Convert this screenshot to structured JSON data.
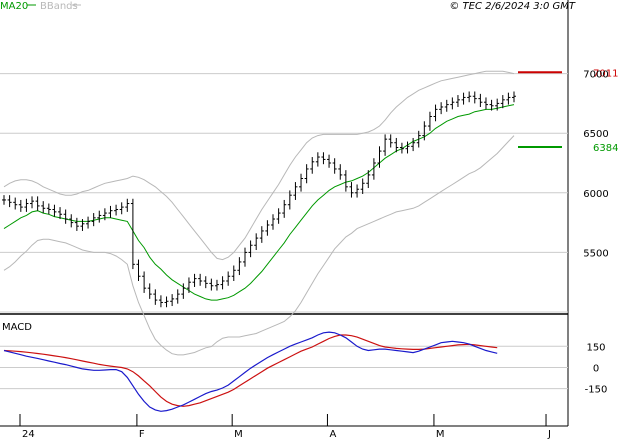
{
  "header": {
    "legend_ma": "MA20",
    "legend_bb": "BBands",
    "copyright": "© TEC 2/6/2024 3:0 GMT"
  },
  "macd_label": "MACD",
  "colors": {
    "price_bar": "#000000",
    "ma20": "#009900",
    "bbands": "#b8b8b8",
    "resistance": "#cc0000",
    "support": "#009900",
    "macd_line": "#1a1acc",
    "signal_line": "#cc1111",
    "grid": "#cccccc",
    "frame": "#000000"
  },
  "chart_data": [
    {
      "type": "ohlc",
      "name": "price",
      "x_tick_labels": [
        "24",
        "F",
        "M",
        "A",
        "M",
        "J"
      ],
      "x_tick_indices": [
        0,
        23,
        40,
        57,
        76,
        96
      ],
      "y_tick_labels": [
        "7000",
        "6500",
        "6000",
        "5500"
      ],
      "y_ticks": [
        7000,
        6500,
        6000,
        5500
      ],
      "ylim": [
        5000,
        7500
      ],
      "levels": [
        {
          "label": "7011",
          "value": 7011,
          "color": "#cc0000"
        },
        {
          "label": "6384",
          "value": 6384,
          "color": "#009900"
        }
      ],
      "close": [
        5940,
        5920,
        5900,
        5880,
        5910,
        5930,
        5890,
        5870,
        5860,
        5840,
        5820,
        5780,
        5750,
        5720,
        5740,
        5760,
        5790,
        5810,
        5830,
        5850,
        5860,
        5880,
        5910,
        5400,
        5300,
        5200,
        5150,
        5100,
        5080,
        5090,
        5110,
        5150,
        5200,
        5250,
        5280,
        5260,
        5240,
        5220,
        5230,
        5260,
        5300,
        5350,
        5420,
        5500,
        5560,
        5620,
        5680,
        5730,
        5780,
        5830,
        5900,
        5980,
        6050,
        6120,
        6200,
        6260,
        6300,
        6280,
        6250,
        6200,
        6150,
        6050,
        6000,
        6030,
        6080,
        6150,
        6250,
        6350,
        6450,
        6420,
        6380,
        6370,
        6390,
        6420,
        6480,
        6560,
        6640,
        6700,
        6720,
        6740,
        6760,
        6780,
        6800,
        6810,
        6790,
        6760,
        6740,
        6730,
        6750,
        6780,
        6800,
        6810
      ],
      "ma20": [
        5700,
        5730,
        5760,
        5790,
        5810,
        5840,
        5850,
        5830,
        5820,
        5800,
        5790,
        5780,
        5770,
        5760,
        5760,
        5760,
        5770,
        5780,
        5790,
        5790,
        5780,
        5770,
        5760,
        5680,
        5600,
        5540,
        5460,
        5400,
        5360,
        5310,
        5270,
        5240,
        5210,
        5180,
        5150,
        5130,
        5110,
        5100,
        5100,
        5110,
        5120,
        5140,
        5170,
        5200,
        5240,
        5290,
        5340,
        5400,
        5460,
        5520,
        5580,
        5650,
        5710,
        5770,
        5830,
        5890,
        5940,
        5980,
        6020,
        6050,
        6070,
        6090,
        6100,
        6120,
        6140,
        6170,
        6210,
        6250,
        6290,
        6320,
        6350,
        6370,
        6400,
        6430,
        6450,
        6470,
        6500,
        6540,
        6570,
        6600,
        6620,
        6640,
        6650,
        6660,
        6680,
        6690,
        6700,
        6700,
        6710,
        6720,
        6730,
        6740
      ],
      "bb_upper": [
        6050,
        6080,
        6100,
        6110,
        6110,
        6100,
        6080,
        6050,
        6030,
        6010,
        5990,
        5980,
        5980,
        5990,
        6010,
        6020,
        6040,
        6060,
        6080,
        6090,
        6100,
        6110,
        6120,
        6140,
        6130,
        6110,
        6080,
        6050,
        6010,
        5970,
        5920,
        5860,
        5800,
        5740,
        5680,
        5620,
        5560,
        5500,
        5450,
        5440,
        5460,
        5500,
        5560,
        5620,
        5700,
        5780,
        5860,
        5930,
        6000,
        6070,
        6150,
        6230,
        6300,
        6360,
        6420,
        6460,
        6480,
        6490,
        6490,
        6490,
        6490,
        6490,
        6490,
        6490,
        6500,
        6510,
        6530,
        6560,
        6610,
        6670,
        6720,
        6760,
        6800,
        6830,
        6860,
        6880,
        6900,
        6920,
        6940,
        6950,
        6960,
        6970,
        6980,
        6990,
        7000,
        7010,
        7020,
        7020,
        7020,
        7020,
        7010,
        7000
      ],
      "bb_lower": [
        5350,
        5380,
        5420,
        5470,
        5510,
        5560,
        5600,
        5610,
        5610,
        5600,
        5590,
        5580,
        5560,
        5540,
        5520,
        5510,
        5500,
        5500,
        5500,
        5490,
        5470,
        5440,
        5400,
        5220,
        5080,
        4970,
        4860,
        4770,
        4720,
        4680,
        4650,
        4640,
        4640,
        4650,
        4660,
        4680,
        4700,
        4710,
        4750,
        4780,
        4790,
        4790,
        4790,
        4800,
        4810,
        4820,
        4840,
        4860,
        4880,
        4900,
        4920,
        4960,
        5010,
        5080,
        5160,
        5240,
        5320,
        5390,
        5460,
        5530,
        5580,
        5630,
        5660,
        5700,
        5720,
        5740,
        5760,
        5780,
        5800,
        5820,
        5840,
        5850,
        5860,
        5870,
        5890,
        5920,
        5950,
        5980,
        6010,
        6040,
        6070,
        6100,
        6130,
        6160,
        6180,
        6210,
        6250,
        6290,
        6330,
        6380,
        6430,
        6480
      ]
    },
    {
      "type": "line",
      "name": "MACD",
      "y_tick_labels": [
        "150",
        "0",
        "-150"
      ],
      "y_ticks": [
        150,
        0,
        -150
      ],
      "ylim": [
        -400,
        350
      ],
      "macd": [
        120,
        110,
        100,
        90,
        80,
        72,
        64,
        55,
        46,
        37,
        28,
        20,
        10,
        0,
        -10,
        -15,
        -20,
        -20,
        -18,
        -15,
        -15,
        -30,
        -70,
        -130,
        -190,
        -240,
        -280,
        -300,
        -310,
        -305,
        -295,
        -280,
        -265,
        -245,
        -225,
        -205,
        -185,
        -170,
        -160,
        -145,
        -125,
        -95,
        -65,
        -35,
        -5,
        20,
        45,
        70,
        90,
        110,
        130,
        150,
        165,
        180,
        195,
        210,
        230,
        245,
        250,
        245,
        230,
        210,
        180,
        150,
        130,
        120,
        125,
        130,
        130,
        125,
        120,
        115,
        110,
        105,
        115,
        130,
        145,
        160,
        175,
        180,
        185,
        180,
        175,
        165,
        150,
        135,
        120,
        110,
        100
      ],
      "signal": [
        120,
        118,
        115,
        112,
        108,
        104,
        99,
        94,
        88,
        82,
        76,
        70,
        62,
        54,
        46,
        38,
        30,
        22,
        15,
        10,
        5,
        0,
        -10,
        -30,
        -60,
        -95,
        -130,
        -170,
        -210,
        -240,
        -260,
        -270,
        -275,
        -270,
        -260,
        -250,
        -235,
        -220,
        -205,
        -190,
        -175,
        -155,
        -130,
        -105,
        -80,
        -55,
        -30,
        -5,
        15,
        35,
        55,
        75,
        95,
        115,
        130,
        145,
        165,
        185,
        205,
        220,
        230,
        230,
        225,
        215,
        200,
        185,
        170,
        155,
        145,
        140,
        135,
        132,
        130,
        128,
        128,
        130,
        135,
        140,
        145,
        150,
        155,
        160,
        162,
        163,
        160,
        155,
        150,
        145,
        140
      ]
    }
  ]
}
